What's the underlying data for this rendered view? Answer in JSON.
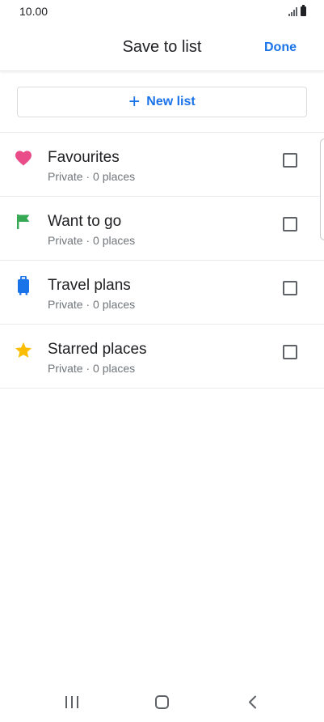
{
  "status_bar": {
    "time": "10.00"
  },
  "header": {
    "title": "Save to list",
    "done_label": "Done"
  },
  "new_list": {
    "label": "New list"
  },
  "lists": [
    {
      "title": "Favourites",
      "subtitle": "Private · 0 places",
      "icon": "heart-icon",
      "icon_color": "#ea4c89",
      "checked": false
    },
    {
      "title": "Want to go",
      "subtitle": "Private · 0 places",
      "icon": "flag-icon",
      "icon_color": "#34a853",
      "checked": false
    },
    {
      "title": "Travel plans",
      "subtitle": "Private · 0 places",
      "icon": "suitcase-icon",
      "icon_color": "#1a73e8",
      "checked": false
    },
    {
      "title": "Starred places",
      "subtitle": "Private · 0 places",
      "icon": "star-icon",
      "icon_color": "#fbbc04",
      "checked": false
    }
  ],
  "colors": {
    "accent": "#1a73e8",
    "text_primary": "#202124",
    "text_secondary": "#70757a",
    "divider": "#e8eaed"
  }
}
